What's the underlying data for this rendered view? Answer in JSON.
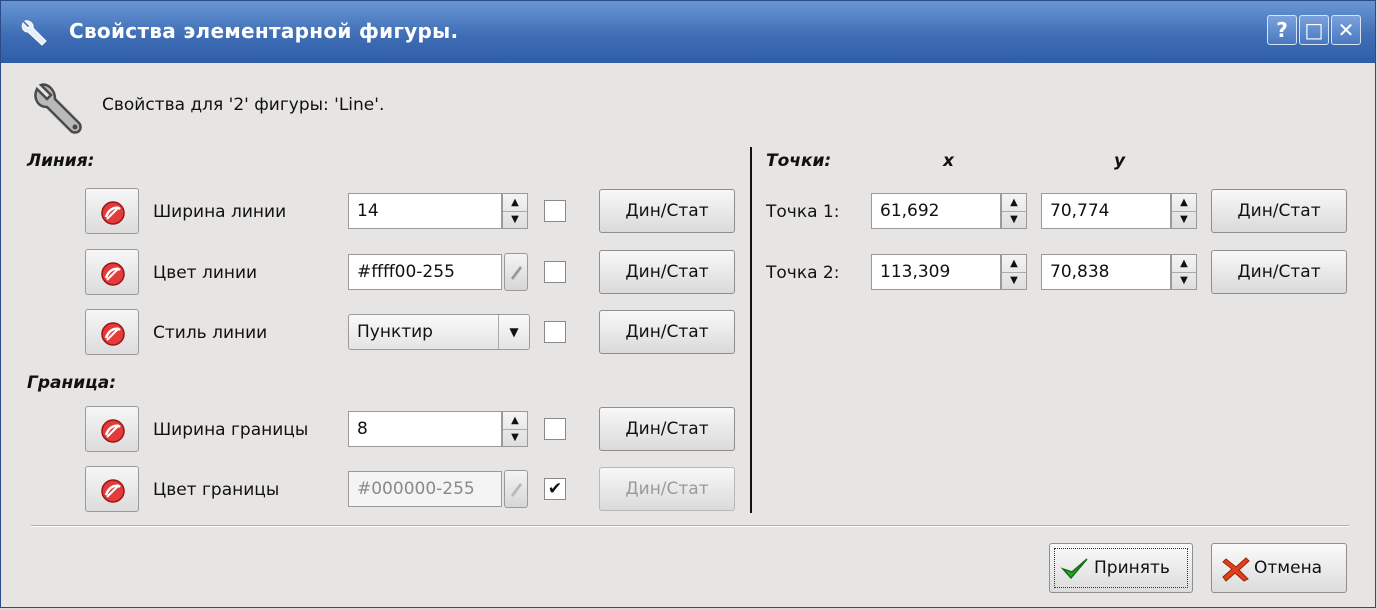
{
  "window": {
    "title": "Свойства элементарной фигуры.",
    "help_label": "?",
    "maximize_label": "□",
    "close_label": "✕"
  },
  "header": {
    "text": "Свойства для '2' фигуры: 'Line'."
  },
  "line_section": {
    "title": "Линия:",
    "width": {
      "label": "Ширина линии",
      "value": "14",
      "checked": false,
      "button": "Дин/Стат"
    },
    "color": {
      "label": "Цвет линии",
      "value": "#ffff00-255",
      "checked": false,
      "button": "Дин/Стат"
    },
    "style": {
      "label": "Стиль линии",
      "value": "Пунктир",
      "checked": false,
      "button": "Дин/Стат"
    }
  },
  "border_section": {
    "title": "Граница:",
    "width": {
      "label": "Ширина границы",
      "value": "8",
      "checked": false,
      "button": "Дин/Стат"
    },
    "color": {
      "label": "Цвет границы",
      "value": "#000000-255",
      "checked": true,
      "button": "Дин/Стат"
    }
  },
  "points_section": {
    "title": "Точки:",
    "col_x": "x",
    "col_y": "y",
    "points": [
      {
        "label": "Точка 1:",
        "x": "61,692",
        "y": "70,774",
        "button": "Дин/Стат"
      },
      {
        "label": "Точка 2:",
        "x": "113,309",
        "y": "70,838",
        "button": "Дин/Стат"
      }
    ]
  },
  "dialog_buttons": {
    "accept": "Принять",
    "cancel": "Отмена"
  },
  "colors": {
    "titlebar": "#3f6eb6",
    "background": "#e6e5e3"
  }
}
